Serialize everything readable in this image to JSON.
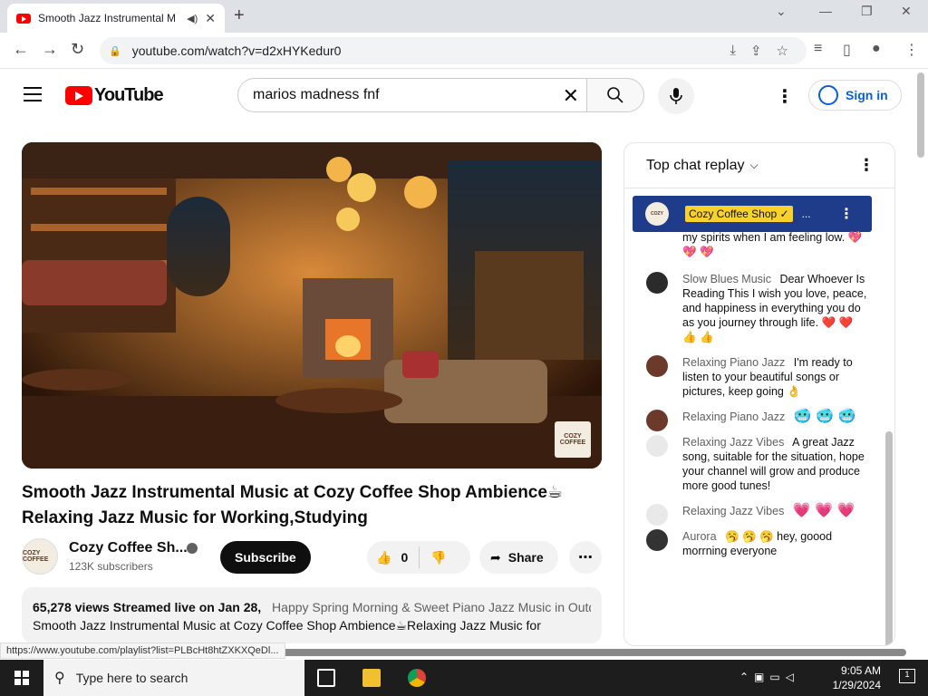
{
  "browser": {
    "tab_title": "Smooth Jazz Instrumental M",
    "url": "youtube.com/watch?v=d2xHYKedur0",
    "status_url": "https://www.youtube.com/playlist?list=PLBcHt8htZXKXQeDl..."
  },
  "header": {
    "logo_text": "YouTube",
    "search_value": "marios madness fnf",
    "signin_label": "Sign in"
  },
  "video": {
    "watermark": "COZY COFFEE",
    "title": "Smooth Jazz Instrumental Music at Cozy Coffee Shop Ambience☕ Relaxing Jazz Music for Working,Studying",
    "channel_name": "Cozy Coffee Sh...",
    "subscribers": "123K subscribers",
    "subscribe_label": "Subscribe",
    "likes": "0",
    "share_label": "Share",
    "views": "65,278 views",
    "streamed": "Streamed live on Jan 28,",
    "related": "Happy Spring Morning & Sweet Piano Jazz Music in Outdo",
    "desc_line2": "Smooth Jazz Instrumental Music at Cozy Coffee Shop Ambience☕Relaxing Jazz Music for"
  },
  "chat": {
    "title": "Top chat replay",
    "pinned_author": "Cozy Coffee Shop ✓",
    "pinned_tail": "my spirits when I am feeling low. 💖 💖 💖",
    "messages": [
      {
        "author": "Slow Blues Music",
        "text": "Dear Whoever Is Reading This I wish you love, peace, and happiness in everything you do as you journey through life. ❤️ ❤️ 👍 👍",
        "avatar_color": "#2b2b2b"
      },
      {
        "author": "Relaxing Piano Jazz",
        "text": "I'm ready to listen to your beautiful songs or pictures, keep going 👌",
        "avatar_color": "#6b3a2a"
      },
      {
        "author": "Relaxing Piano Jazz",
        "text": "🥶 🥶 🥶",
        "avatar_color": "#6b3a2a"
      },
      {
        "author": "Relaxing Jazz Vibes",
        "text": "A great Jazz song, suitable for the situation, hope your channel will grow and produce more good tunes!",
        "avatar_color": "#e9e9e9"
      },
      {
        "author": "Relaxing Jazz Vibes",
        "text": "💗 💗 💗",
        "avatar_color": "#e9e9e9"
      },
      {
        "author": "Aurora",
        "text": "🥱 🥱 🥱 hey, goood morrning everyone",
        "avatar_color": "#333333"
      }
    ]
  },
  "taskbar": {
    "search_placeholder": "Type here to search",
    "time": "9:05 AM",
    "date": "1/29/2024",
    "notif_count": "1"
  }
}
